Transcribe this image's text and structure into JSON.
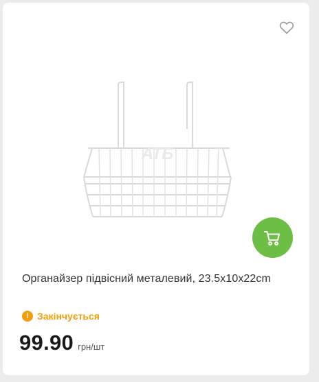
{
  "product": {
    "title": "Органайзер підвісний металевий, 23.5x10x22cm",
    "image_watermark": "АТБ",
    "status_text": "Закінчується",
    "status_icon": "!",
    "price": "99.90",
    "unit": "грн/шт"
  },
  "icons": {
    "favorite": "heart-outline-icon",
    "cart": "shopping-cart-icon",
    "status": "warning-circle-icon"
  },
  "colors": {
    "accent_green": "#6cbe45",
    "status_orange": "#f59e0b",
    "text": "#333333",
    "price": "#1a1a1a"
  }
}
